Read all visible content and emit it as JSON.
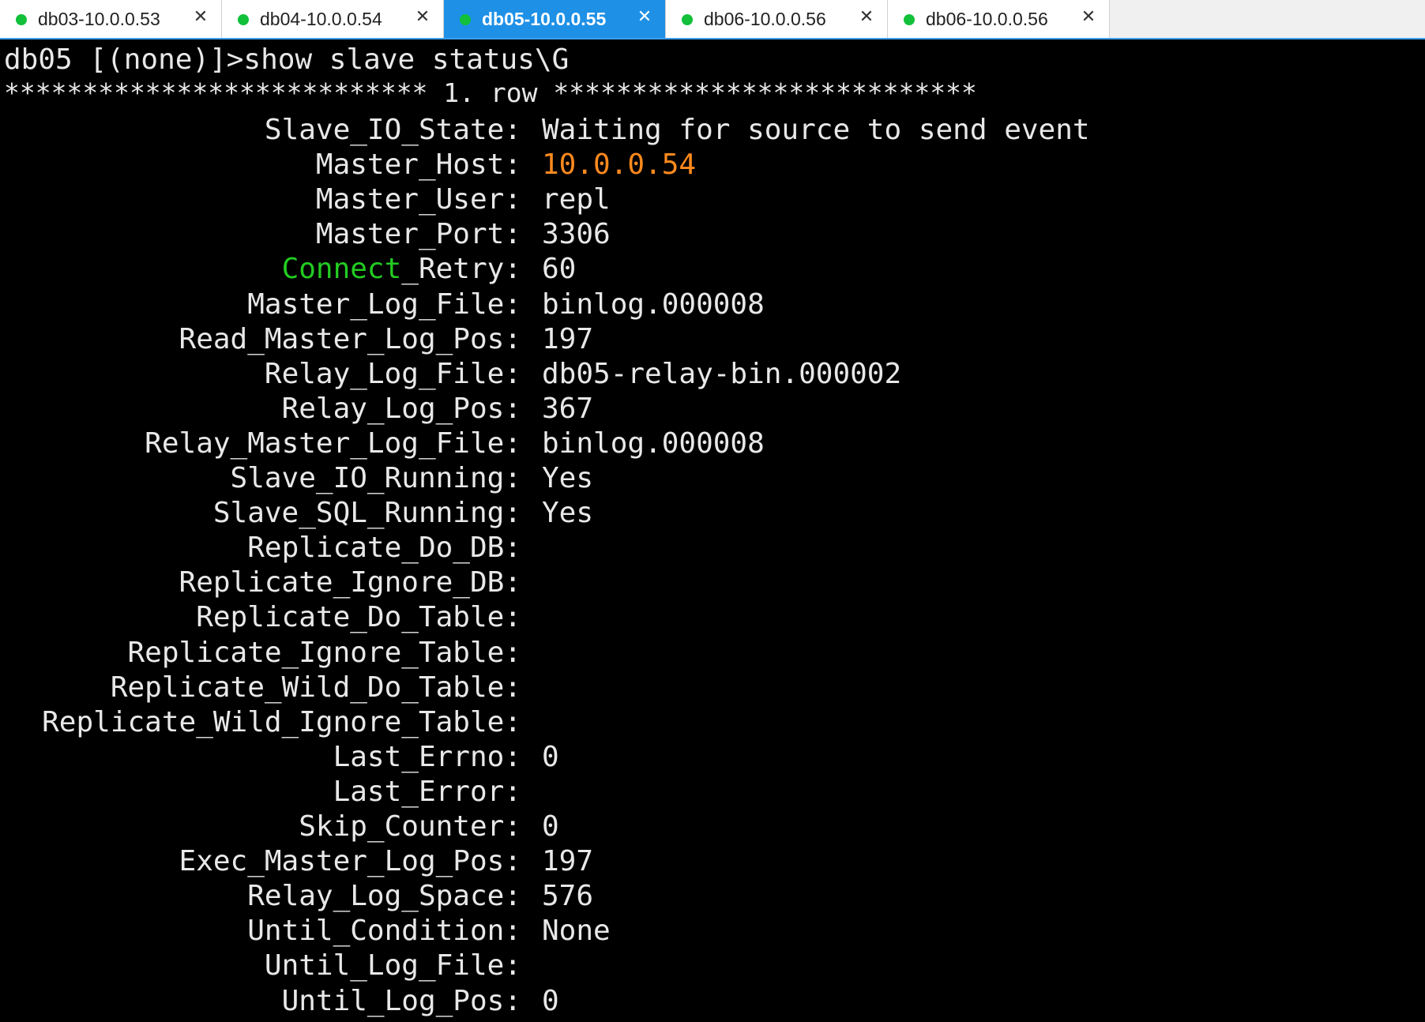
{
  "tabs": [
    {
      "label": "db03-10.0.0.53",
      "status_color": "#12c03a",
      "active": false,
      "close_icon": "close-icon"
    },
    {
      "label": "db04-10.0.0.54",
      "status_color": "#12c03a",
      "active": false,
      "close_icon": "close-icon"
    },
    {
      "label": "db05-10.0.0.55",
      "status_color": "#12c03a",
      "active": true,
      "close_icon": "close-icon"
    },
    {
      "label": "db06-10.0.0.56",
      "status_color": "#12c03a",
      "active": false,
      "close_icon": "close-icon"
    },
    {
      "label": "db06-10.0.0.56",
      "status_color": "#12c03a",
      "active": false,
      "close_icon": "close-icon"
    }
  ],
  "terminal": {
    "prompt": "db05 [(none)]>show slave status\\G",
    "row_header": "*************************** 1. row ***************************",
    "fields": [
      {
        "label": "Slave_IO_State:",
        "value": "Waiting for source to send event"
      },
      {
        "label": "Master_Host:",
        "value": "10.0.0.54",
        "value_color": "#ff8a1e"
      },
      {
        "label": "Master_User:",
        "value": "repl"
      },
      {
        "label": "Master_Port:",
        "value": "3306"
      },
      {
        "label_highlight": "Connect",
        "label": "_Retry:",
        "label_highlight_color": "#22cc22",
        "value": "60"
      },
      {
        "label": "Master_Log_File:",
        "value": "binlog.000008"
      },
      {
        "label": "Read_Master_Log_Pos:",
        "value": "197"
      },
      {
        "label": "Relay_Log_File:",
        "value": "db05-relay-bin.000002"
      },
      {
        "label": "Relay_Log_Pos:",
        "value": "367"
      },
      {
        "label": "Relay_Master_Log_File:",
        "value": "binlog.000008"
      },
      {
        "label": "Slave_IO_Running:",
        "value": "Yes"
      },
      {
        "label": "Slave_SQL_Running:",
        "value": "Yes"
      },
      {
        "label": "Replicate_Do_DB:",
        "value": ""
      },
      {
        "label": "Replicate_Ignore_DB:",
        "value": ""
      },
      {
        "label": "Replicate_Do_Table:",
        "value": ""
      },
      {
        "label": "Replicate_Ignore_Table:",
        "value": ""
      },
      {
        "label": "Replicate_Wild_Do_Table:",
        "value": ""
      },
      {
        "label": "Replicate_Wild_Ignore_Table:",
        "value": ""
      },
      {
        "label": "Last_Errno:",
        "value": "0"
      },
      {
        "label": "Last_Error:",
        "value": ""
      },
      {
        "label": "Skip_Counter:",
        "value": "0"
      },
      {
        "label": "Exec_Master_Log_Pos:",
        "value": "197"
      },
      {
        "label": "Relay_Log_Space:",
        "value": "576"
      },
      {
        "label": "Until_Condition:",
        "value": "None"
      },
      {
        "label": "Until_Log_File:",
        "value": ""
      },
      {
        "label": "Until_Log_Pos:",
        "value": "0"
      }
    ]
  },
  "colors": {
    "background": "#000000",
    "text": "#e8e8e8",
    "active_tab": "#1e90e6",
    "status_dot": "#12c03a"
  }
}
